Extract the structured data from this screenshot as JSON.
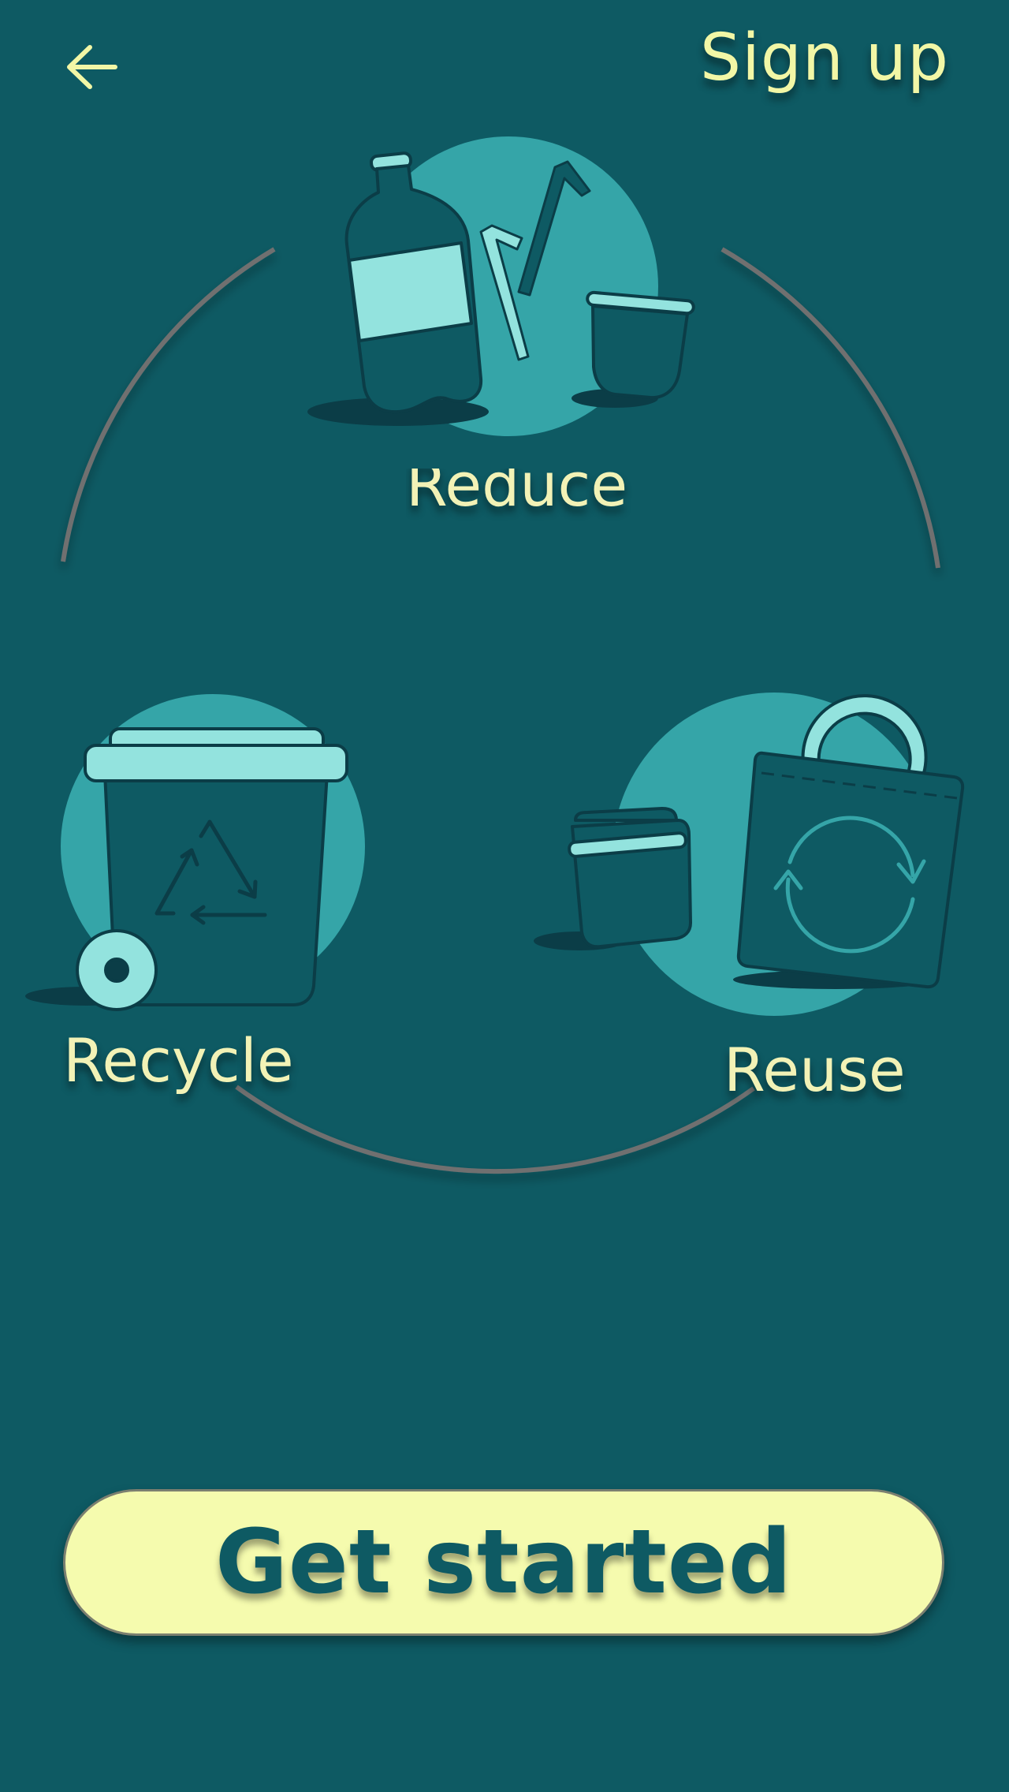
{
  "header": {
    "back_icon": "arrow-left-icon",
    "sign_up_label": "Sign up"
  },
  "illustration": {
    "reduce_label": "Reduce",
    "recycle_label": "Recycle",
    "reuse_label": "Reuse",
    "icons": [
      "bottle-icon",
      "straw-icon",
      "cup-icon",
      "recycle-bin-icon",
      "recycle-triangle-icon",
      "container-icon",
      "tote-bag-icon",
      "refresh-arrows-icon"
    ]
  },
  "cta": {
    "get_started_label": "Get started"
  },
  "colors": {
    "background": "#0e5a63",
    "accent_text": "#f2f7a6",
    "button_bg": "#f5fbae",
    "circle": "#35a5a8",
    "light_teal": "#93e3de",
    "dark_outline": "#0b3d47",
    "ring": "#6f6f6f"
  }
}
